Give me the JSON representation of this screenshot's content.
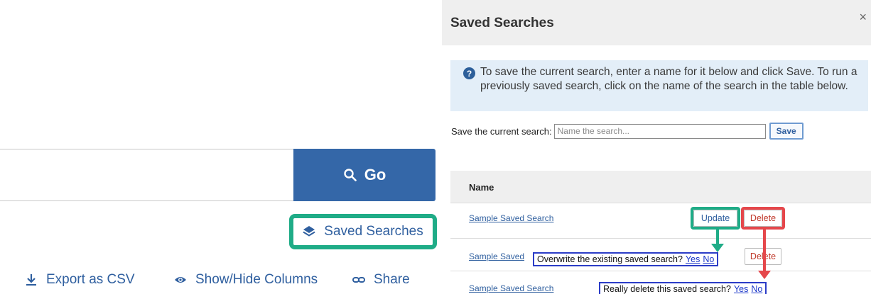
{
  "search": {
    "go_label": "Go"
  },
  "links": {
    "saved_searches": "Saved Searches",
    "export_csv": "Export as CSV",
    "show_hide_columns": "Show/Hide Columns",
    "share": "Share"
  },
  "panel": {
    "title": "Saved Searches",
    "close": "×",
    "info_icon": "?",
    "info_text": "To save the current search, enter a name for it below and click Save. To run a previously saved search, click on the name of the search in the table below.",
    "save_label": "Save the current search:",
    "name_placeholder": "Name the search...",
    "save_button": "Save",
    "table": {
      "col_name": "Name",
      "rows": [
        {
          "name": "Sample Saved Search",
          "update": "Update",
          "delete": "Delete"
        },
        {
          "name": "Sample Saved",
          "delete": "Delete"
        },
        {
          "name": "Sample Saved Search"
        }
      ]
    },
    "overwrite_confirm": {
      "text": "Overwrite the existing saved search?",
      "yes": "Yes",
      "no": "No"
    },
    "delete_confirm": {
      "text": "Really delete this saved search?",
      "yes": "Yes",
      "no": "No"
    }
  },
  "colors": {
    "primary": "#3467a8",
    "highlight_green": "#1fac87",
    "highlight_red": "#e5474b",
    "link": "#2f5f9f",
    "confirm_border": "#2b3cc7"
  },
  "icons": [
    "search-icon",
    "layers-icon",
    "download-icon",
    "eye-icon",
    "link-icon",
    "question-circle-icon",
    "close-icon"
  ]
}
